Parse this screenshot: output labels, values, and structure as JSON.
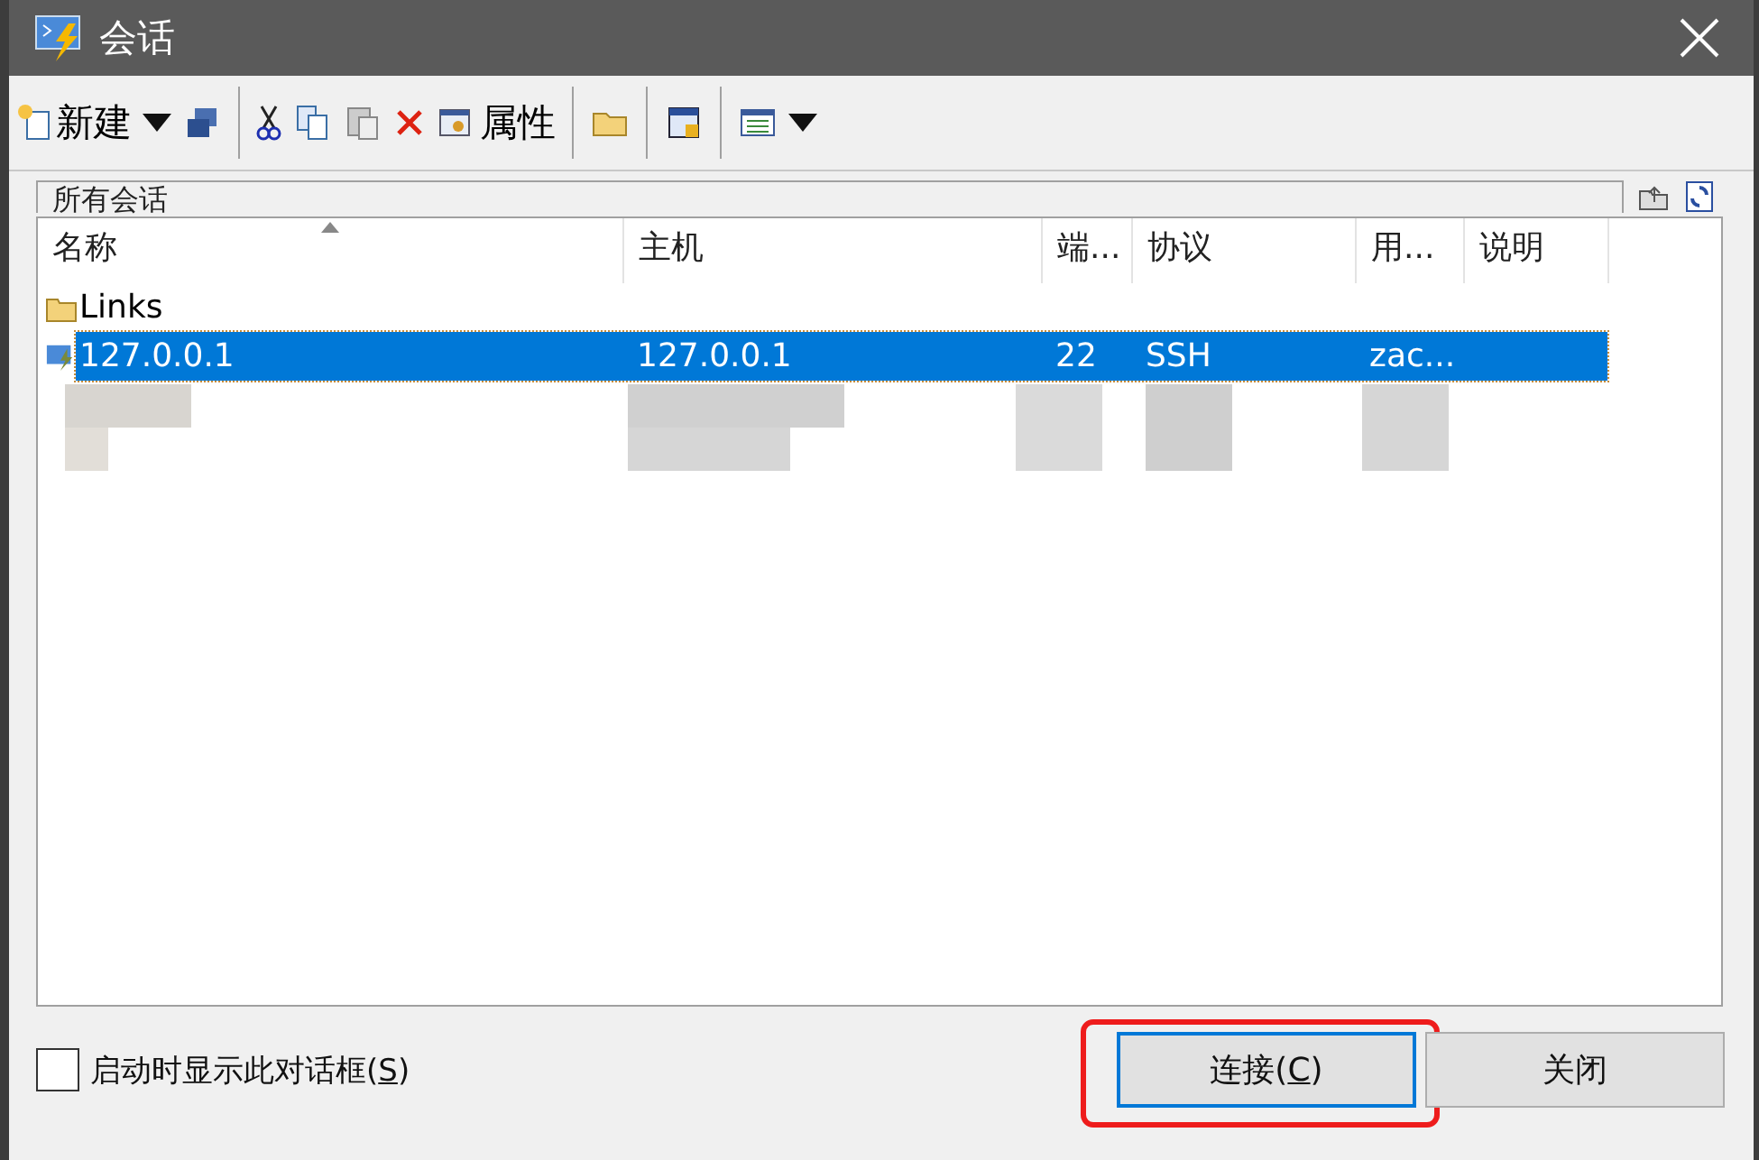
{
  "window": {
    "title": "会话"
  },
  "toolbar": [
    {
      "kind": "new",
      "label": "新建"
    },
    {
      "kind": "caret"
    },
    {
      "kind": "clone"
    },
    {
      "kind": "sep"
    },
    {
      "kind": "cut"
    },
    {
      "kind": "copy"
    },
    {
      "kind": "paste"
    },
    {
      "kind": "delete"
    },
    {
      "kind": "properties",
      "label": "属性"
    },
    {
      "kind": "sep"
    },
    {
      "kind": "folder"
    },
    {
      "kind": "sep"
    },
    {
      "kind": "shortcut"
    },
    {
      "kind": "sep"
    },
    {
      "kind": "view"
    },
    {
      "kind": "caret"
    }
  ],
  "folder_bar": {
    "label": "所有会话"
  },
  "table": {
    "columns": [
      {
        "label": "名称",
        "sorted": true
      },
      {
        "label": "主机",
        "sorted": false
      },
      {
        "label": "端...",
        "sorted": false
      },
      {
        "label": "协议",
        "sorted": false
      },
      {
        "label": "用...",
        "sorted": false
      },
      {
        "label": "说明",
        "sorted": false
      }
    ],
    "rows": [
      {
        "kind": "folder",
        "name": "Links",
        "selected": false
      },
      {
        "kind": "session",
        "name": "127.0.0.1",
        "host": "127.0.0.1",
        "port": "22",
        "protocol": "SSH",
        "user": "zac...",
        "selected": true
      },
      {
        "kind": "redacted"
      }
    ]
  },
  "startup_checkbox": {
    "before": "启动时显示此对话框(",
    "key": "S",
    "after": ")",
    "checked": false
  },
  "buttons": [
    {
      "before": "连接(",
      "key": "C",
      "after": ")",
      "highlighted": true,
      "focused": true
    },
    {
      "label": "关闭",
      "highlighted": false,
      "focused": false
    }
  ]
}
